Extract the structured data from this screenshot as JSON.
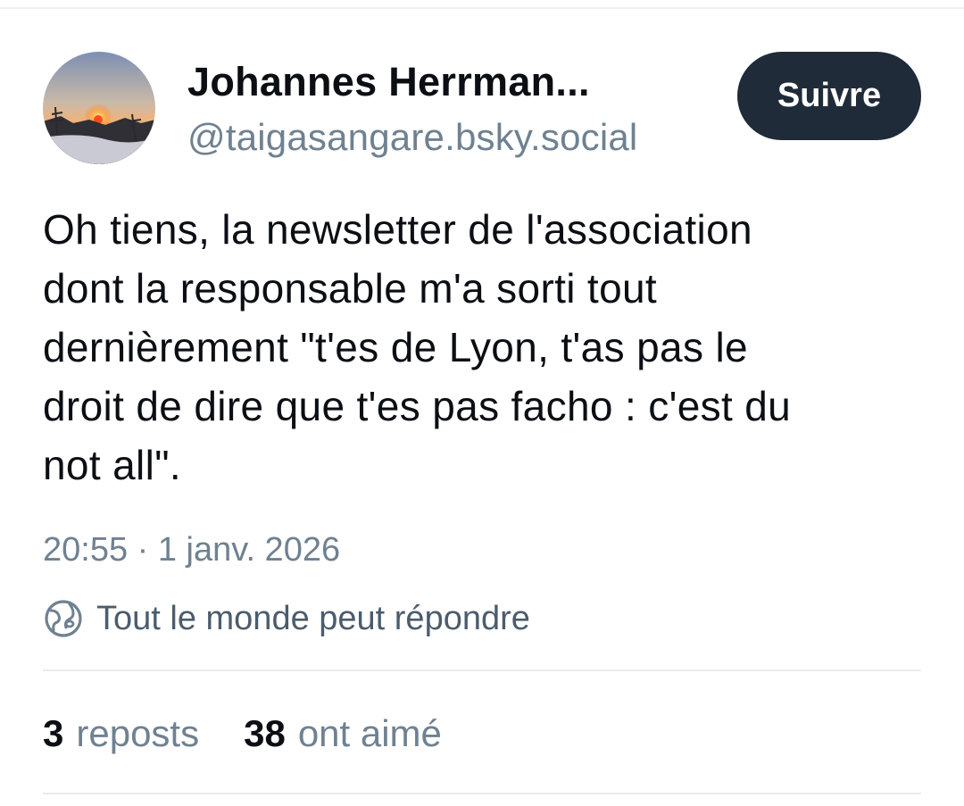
{
  "author": {
    "display_name": "Johannes Herrman...",
    "handle": "@taigasangare.bsky.social",
    "avatar": "avatar-sunset-landscape"
  },
  "follow_button": {
    "label": "Suivre"
  },
  "post": {
    "text_lines": [
      "Oh tiens, la newsletter de l'association",
      "dont la responsable m'a sorti tout",
      "dernièrement \"t'es de Lyon, t'as pas le",
      "droit de dire que t'es pas facho : c'est du",
      "not all\"."
    ],
    "timestamp": "20:55 · 1 janv. 2026",
    "reply_setting": {
      "icon": "globe-icon",
      "label": "Tout le monde peut répondre"
    }
  },
  "stats": {
    "reposts": {
      "count": "3",
      "label": "reposts"
    },
    "likes": {
      "count": "38",
      "label": "ont aimé"
    }
  },
  "colors": {
    "follow_button_bg": "#202b39",
    "secondary_text": "#6f8191",
    "primary_text": "#0b0f14"
  }
}
